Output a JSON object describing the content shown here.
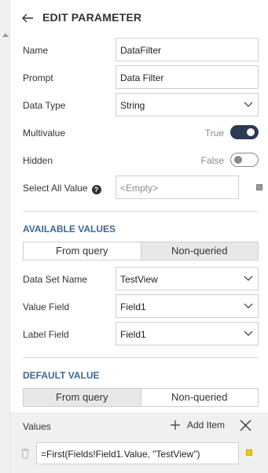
{
  "header": {
    "title": "EDIT PARAMETER"
  },
  "fields": {
    "name": {
      "label": "Name",
      "value": "DataFilter"
    },
    "prompt": {
      "label": "Prompt",
      "value": "Data Filter"
    },
    "data_type": {
      "label": "Data Type",
      "value": "String"
    },
    "multivalue": {
      "label": "Multivalue",
      "state_text": "True",
      "on": true
    },
    "hidden": {
      "label": "Hidden",
      "state_text": "False",
      "on": false
    },
    "select_all": {
      "label": "Select All Value",
      "help": "?",
      "placeholder": "<Empty>"
    }
  },
  "available_values": {
    "title": "AVAILABLE VALUES",
    "tabs": [
      "From query",
      "Non-queried"
    ],
    "active_tab": 0,
    "dataset": {
      "label": "Data Set Name",
      "value": "TestView"
    },
    "value_field": {
      "label": "Value Field",
      "value": "Field1"
    },
    "label_field": {
      "label": "Label Field",
      "value": "Field1"
    }
  },
  "default_value": {
    "title": "DEFAULT VALUE",
    "tabs": [
      "From query",
      "Non-queried"
    ],
    "active_tab": 1,
    "values_label": "Values",
    "add_item": "Add Item",
    "expression": "=First(Fields!Field1.Value, \"TestView\")"
  },
  "colors": {
    "accent": "#3f6796",
    "toggle_on": "#2b3a55",
    "expression_marker": "#f2c811"
  }
}
